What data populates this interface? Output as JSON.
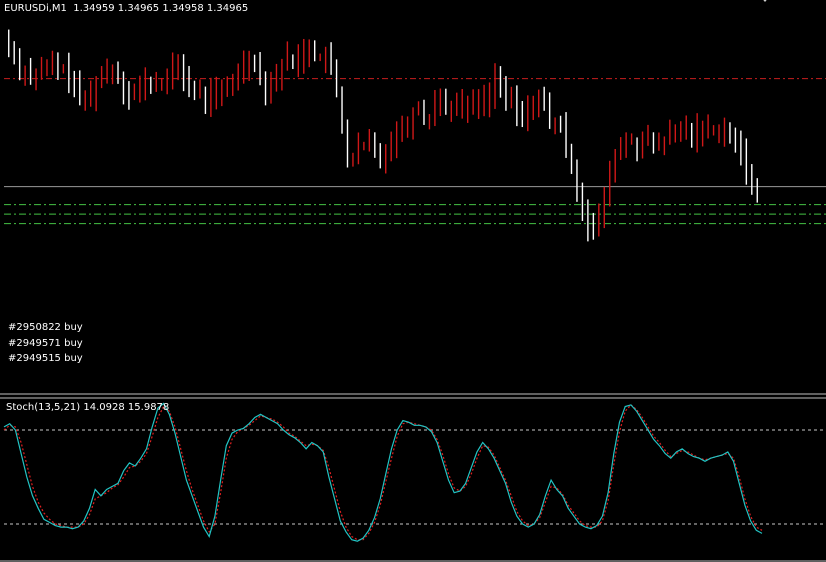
{
  "window": {
    "symbol_timeframe": "EURUSDi,M1",
    "ohlc_text": "1.34959 1.34965 1.34958 1.34965"
  },
  "colors": {
    "background": "#000000",
    "bull_candle": "#d01818",
    "bear_candle": "#ffffff",
    "current_price_line": "#c81e1e",
    "order_line": "#44c244",
    "separator": "#c0c0c0",
    "stoch_main": "#22c4c4",
    "stoch_signal": "#e02020",
    "stoch_levels": "#c8c8c8"
  },
  "chart_data": [
    {
      "type": "candlestick",
      "title": "EURUSDi,M1",
      "ylim": [
        1.3446,
        1.3507
      ],
      "current_price": 1.34965,
      "candle_count": 150,
      "price_path_close": [
        1.3502,
        1.35,
        1.3498,
        1.3498,
        1.3497,
        1.3497,
        1.3498,
        1.3498,
        1.3499,
        1.3498,
        1.3498,
        1.3497,
        1.3495,
        1.3493,
        1.3493,
        1.3494,
        1.3496,
        1.3497,
        1.3498,
        1.3498,
        1.3497,
        1.3495,
        1.3494,
        1.3494,
        1.3495,
        1.3496,
        1.3495,
        1.3496,
        1.3496,
        1.3496,
        1.3498,
        1.3499,
        1.3497,
        1.3495,
        1.3494,
        1.3494,
        1.3493,
        1.3494,
        1.3494,
        1.3494,
        1.3495,
        1.3496,
        1.3498,
        1.3499,
        1.35,
        1.3499,
        1.3497,
        1.3495,
        1.3496,
        1.3497,
        1.3499,
        1.35,
        1.3499,
        1.35,
        1.3501,
        1.3502,
        1.35,
        1.35,
        1.35,
        1.3498,
        1.3494,
        1.3489,
        1.3483,
        1.3483,
        1.3485,
        1.3485,
        1.3486,
        1.3484,
        1.3483,
        1.3485,
        1.3486,
        1.3488,
        1.3488,
        1.3489,
        1.3491,
        1.3492,
        1.349,
        1.349,
        1.3493,
        1.3493,
        1.3492,
        1.3492,
        1.3492,
        1.3492,
        1.3492,
        1.3492,
        1.3493,
        1.3493,
        1.3494,
        1.3497,
        1.3494,
        1.3493,
        1.3493,
        1.3491,
        1.349,
        1.3491,
        1.3493,
        1.3493,
        1.3492,
        1.3489,
        1.3489,
        1.3488,
        1.3485,
        1.3482,
        1.3478,
        1.3475,
        1.3472,
        1.3471,
        1.3473,
        1.3477,
        1.348,
        1.3484,
        1.3485,
        1.3486,
        1.3486,
        1.3485,
        1.3486,
        1.3486,
        1.3485,
        1.3486,
        1.3486,
        1.3487,
        1.3487,
        1.3488,
        1.3488,
        1.3487,
        1.3488,
        1.3488,
        1.3488,
        1.3488,
        1.3488,
        1.3488,
        1.3487,
        1.3485,
        1.3484,
        1.3481,
        1.3479,
        1.3478
      ],
      "orders": [
        {
          "label": "#2950822 buy",
          "price": 1.34754
        },
        {
          "label": "#2949571 buy",
          "price": 1.34738
        },
        {
          "label": "#2949515 buy",
          "price": 1.34722
        }
      ]
    },
    {
      "type": "line",
      "title": "Stoch(13,5,21)",
      "values_text": "14.0928 15.9878",
      "main_value": 14.0928,
      "signal_value": 15.9878,
      "levels": [
        80,
        20
      ],
      "ylim": [
        0,
        100
      ],
      "series": [
        {
          "name": "Stoch main",
          "values": [
            82,
            84,
            80,
            65,
            50,
            38,
            30,
            23,
            21,
            19,
            18,
            18,
            17,
            18,
            22,
            30,
            42,
            38,
            42,
            44,
            46,
            54,
            59,
            57,
            62,
            68,
            82,
            94,
            97,
            90,
            78,
            63,
            48,
            38,
            28,
            18,
            12,
            25,
            48,
            70,
            78,
            80,
            81,
            84,
            88,
            90,
            88,
            86,
            84,
            80,
            77,
            75,
            72,
            68,
            72,
            70,
            66,
            50,
            36,
            22,
            15,
            10,
            9,
            11,
            16,
            24,
            36,
            52,
            68,
            80,
            86,
            85,
            83,
            83,
            82,
            79,
            72,
            60,
            48,
            40,
            41,
            46,
            56,
            66,
            72,
            68,
            62,
            54,
            46,
            34,
            25,
            20,
            18,
            20,
            26,
            38,
            48,
            42,
            38,
            30,
            25,
            20,
            18,
            17,
            19,
            25,
            40,
            65,
            85,
            95,
            96,
            92,
            86,
            80,
            74,
            70,
            65,
            62,
            66,
            68,
            65,
            63,
            62,
            60,
            62,
            63,
            64,
            66,
            60,
            46,
            32,
            22,
            16,
            14
          ]
        },
        {
          "name": "Stoch signal",
          "values": [
            80,
            83,
            82,
            72,
            58,
            44,
            34,
            27,
            23,
            20,
            19,
            18,
            18,
            18,
            20,
            26,
            36,
            38,
            40,
            43,
            45,
            50,
            56,
            57,
            60,
            65,
            76,
            88,
            95,
            92,
            82,
            68,
            54,
            42,
            32,
            22,
            15,
            20,
            40,
            62,
            74,
            79,
            81,
            83,
            86,
            89,
            88,
            87,
            85,
            82,
            78,
            76,
            73,
            70,
            71,
            70,
            67,
            56,
            42,
            28,
            18,
            12,
            10,
            10,
            14,
            21,
            32,
            47,
            62,
            76,
            84,
            85,
            84,
            83,
            82,
            80,
            74,
            64,
            52,
            43,
            41,
            44,
            52,
            62,
            70,
            69,
            64,
            56,
            48,
            38,
            28,
            22,
            19,
            20,
            24,
            34,
            44,
            43,
            39,
            32,
            27,
            22,
            19,
            18,
            18,
            22,
            35,
            58,
            79,
            92,
            96,
            93,
            88,
            82,
            76,
            72,
            67,
            63,
            65,
            67,
            66,
            64,
            62,
            61,
            62,
            63,
            64,
            65,
            62,
            50,
            36,
            25,
            18,
            16
          ]
        }
      ]
    }
  ]
}
